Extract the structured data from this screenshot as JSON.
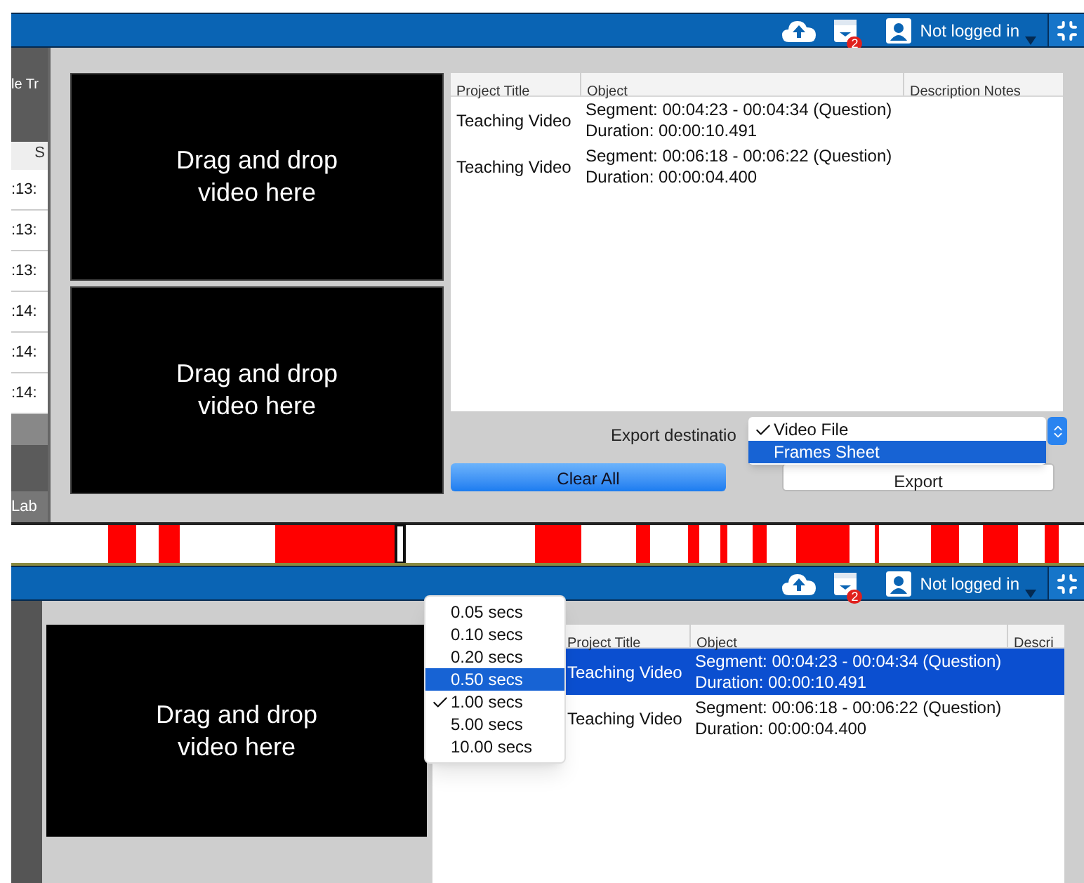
{
  "upper": {
    "top_bar": {
      "notification_count": "2",
      "user_label": "Not logged in"
    },
    "background_app": {
      "header": "le Tr",
      "column": "S",
      "cells": [
        ":13:",
        ":13:",
        ":13:",
        ":14:",
        ":14:",
        ":14:"
      ],
      "footer": "Lab"
    },
    "videos": [
      "Drag and drop video here",
      "Drag and drop video here"
    ],
    "table": {
      "columns": [
        "Project Title",
        "Object",
        "Description Notes"
      ],
      "rows": [
        {
          "project": "Teaching Video",
          "object": [
            "Segment: 00:04:23 - 00:04:34 (Question)",
            "Duration: 00:00:10.491"
          ],
          "selected": false
        },
        {
          "project": "Teaching Video",
          "object": [
            "Segment: 00:06:18 - 00:06:22 (Question)",
            "Duration: 00:00:04.400"
          ],
          "selected": false
        }
      ]
    },
    "export_label": "Export destinatio",
    "export_menu": [
      {
        "label": "Video File",
        "checked": true,
        "selected": false
      },
      {
        "label": "Frames Sheet",
        "checked": false,
        "selected": true
      }
    ],
    "buttons": [
      {
        "kind": "primary",
        "label": "Clear All"
      },
      {
        "kind": "secondary",
        "label": "Export"
      }
    ]
  },
  "lower": {
    "top_bar": {
      "notification_count": "2",
      "user_label": "Not logged in"
    },
    "videos": [
      "Drag and drop video here"
    ],
    "table": {
      "columns": [
        "Project Title",
        "Object",
        "Descri"
      ],
      "rows": [
        {
          "project": "Teaching Video",
          "object": [
            "Segment: 00:04:23 - 00:04:34 (Question)",
            "Duration: 00:00:10.491"
          ],
          "selected": true
        },
        {
          "project": "Teaching Video",
          "object": [
            "Segment: 00:06:18 - 00:06:22 (Question)",
            "Duration: 00:00:04.400"
          ],
          "selected": false
        }
      ]
    },
    "interval_menu": [
      {
        "label": "0.05 secs",
        "checked": false,
        "selected": false
      },
      {
        "label": "0.10 secs",
        "checked": false,
        "selected": false
      },
      {
        "label": "0.20 secs",
        "checked": false,
        "selected": false
      },
      {
        "label": "0.50 secs",
        "checked": false,
        "selected": true
      },
      {
        "label": "1.00 secs",
        "checked": true,
        "selected": false
      },
      {
        "label": "5.00 secs",
        "checked": false,
        "selected": false
      },
      {
        "label": "10.00 secs",
        "checked": false,
        "selected": false
      }
    ]
  }
}
